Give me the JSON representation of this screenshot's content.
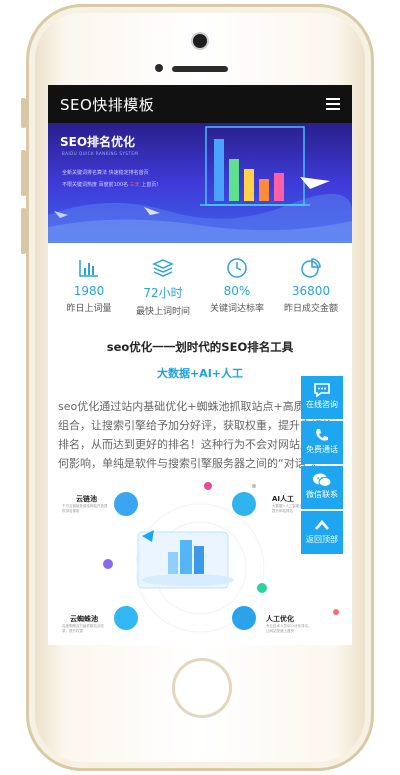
{
  "header": {
    "brand": "SEO快排模板",
    "menu_icon": "hamburger-menu-icon"
  },
  "banner": {
    "title": "SEO排名优化",
    "subtitle": "BAIDU QUICK RANKING SYSTEM",
    "line1": "全新关键词排名算法 快速稳定排名首页",
    "line2_prefix": "不限关键词热度 百度前100名 ",
    "line2_highlight": "三天",
    "line2_suffix": " 上首页！",
    "accent_color": "#ff5a6a"
  },
  "stats": [
    {
      "value": "1980",
      "label": "昨日上词量",
      "icon": "bar-chart-icon"
    },
    {
      "value": "72小时",
      "label": "最快上词时间",
      "icon": "layers-icon"
    },
    {
      "value": "80%",
      "label": "关键词达标率",
      "icon": "clock-icon"
    },
    {
      "value": "36800",
      "label": "昨日成交金额",
      "icon": "pie-chart-icon"
    }
  ],
  "headline": "seo优化一一划时代的SEO排名工具",
  "subline": "大数据+AI+人工",
  "paragraph": "seo优化通过站内基础优化+蜘蛛池抓取站点+高质量外链组合，让搜索引擎给予加分好评，获取权重，提升良好的排名，从而达到更好的排名！这种行为不会对网站产生任何影响，单纯是软件与搜索引擎服务器之间的“对话”。",
  "diagram": {
    "nodes": [
      {
        "title": "云链池",
        "desc": "千万云链接免费给网站开放提供排名使用"
      },
      {
        "title": "AI人工",
        "desc": "大数据+人工智能分析，精准提升网站排名"
      },
      {
        "title": "云蜘蛛池",
        "desc": "百度蜘蛛百万级抓取站点收录，提升权重"
      },
      {
        "title": "人工优化",
        "desc": "专业技术人员SEO优化排名，让网站快速上首页"
      }
    ]
  },
  "float_bar": [
    {
      "label": "在线咨询",
      "icon": "chat-bubble-icon"
    },
    {
      "label": "免费通话",
      "icon": "phone-icon"
    },
    {
      "label": "微信联系",
      "icon": "wechat-icon"
    },
    {
      "label": "返回顶部",
      "icon": "arrow-up-icon"
    }
  ],
  "colors": {
    "primary": "#1ea7f0",
    "stat_value": "#2aa3d8",
    "topbar": "#111111"
  }
}
